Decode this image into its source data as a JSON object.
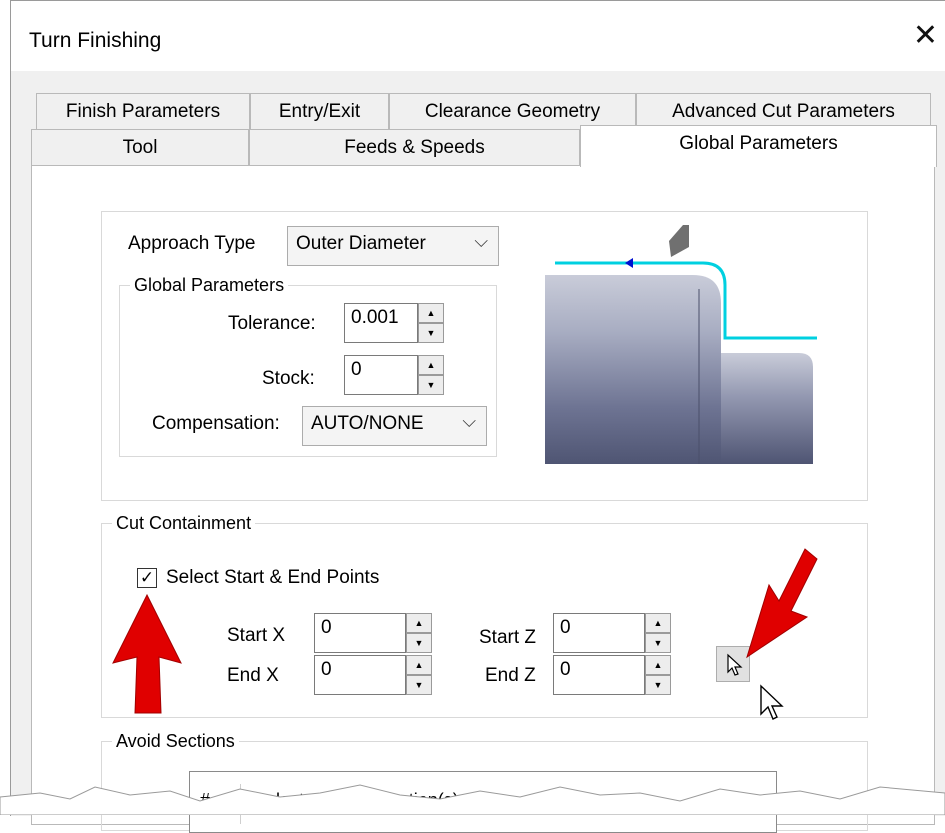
{
  "window": {
    "title": "Turn Finishing",
    "close_symbol": "✕"
  },
  "tabs_back": [
    "Finish Parameters",
    "Entry/Exit",
    "Clearance Geometry",
    "Advanced Cut Parameters"
  ],
  "tabs_front": [
    "Tool",
    "Feeds & Speeds",
    "Global Parameters"
  ],
  "active_tab": "Global Parameters",
  "approach": {
    "label": "Approach Type",
    "value": "Outer Diameter"
  },
  "global_params": {
    "legend": "Global Parameters",
    "tolerance_label": "Tolerance:",
    "tolerance_value": "0.001",
    "stock_label": "Stock:",
    "stock_value": "0",
    "compensation_label": "Compensation:",
    "compensation_value": "AUTO/NONE"
  },
  "cut_containment": {
    "legend": "Cut Containment",
    "checkbox_label": "Select Start & End Points",
    "checked": true,
    "start_x_label": "Start X",
    "start_x_value": "0",
    "end_x_label": "End X",
    "end_x_value": "0",
    "start_z_label": "Start Z",
    "start_z_value": "0",
    "end_z_label": "End Z",
    "end_z_value": "0"
  },
  "avoid_sections": {
    "legend": "Avoid Sections",
    "column_header_1": "#",
    "column_header_2": "Selected Avoid Section(s)"
  },
  "colors": {
    "toolpath": "#00d0e0",
    "arrow": "#e00000",
    "part": "#8a8fa8"
  },
  "icons": [
    "close-icon",
    "chevron-down-icon",
    "cursor-pick-icon",
    "mouse-pointer-icon",
    "red-arrow-annotation"
  ]
}
